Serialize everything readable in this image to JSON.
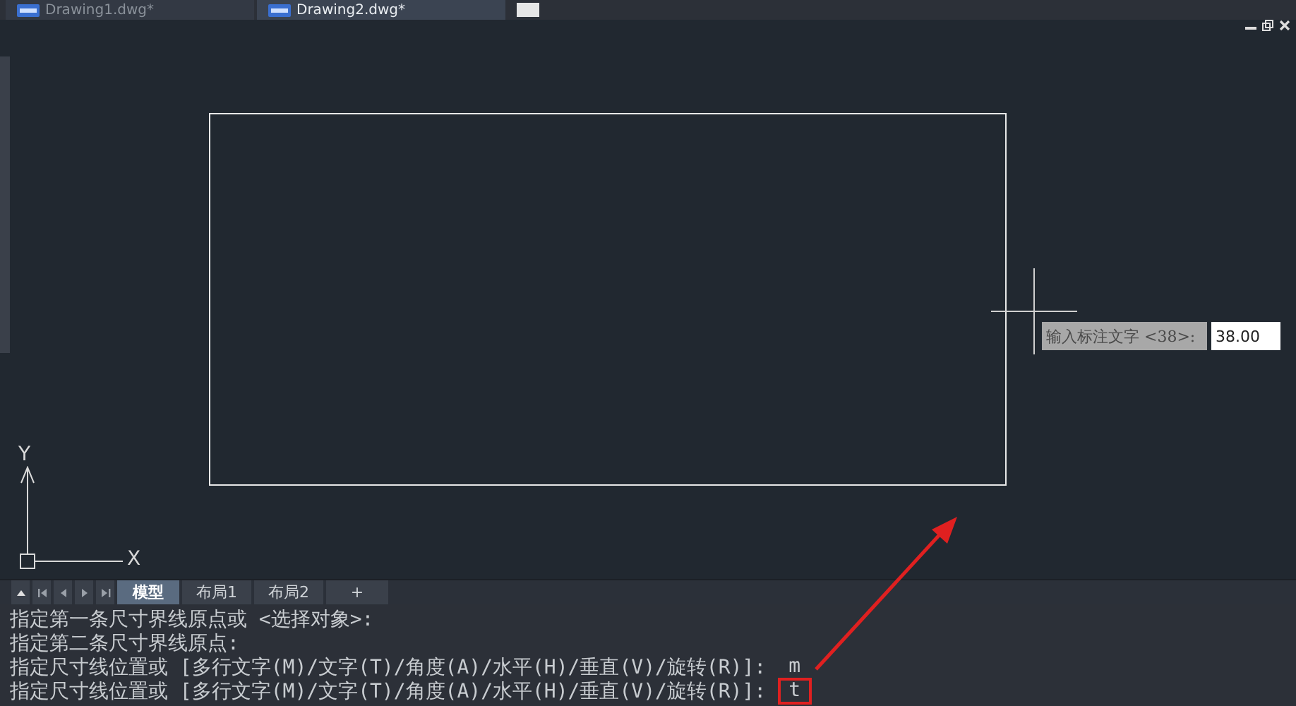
{
  "document_tabs": [
    {
      "label": "Drawing1.dwg*",
      "selected": false
    },
    {
      "label": "Drawing2.dwg*",
      "selected": true
    }
  ],
  "canvas": {
    "axis_labels": {
      "y": "Y",
      "x": "X"
    },
    "dimension_prompt": {
      "label": "输入标注文字 <38>:",
      "value": "38.00"
    }
  },
  "layout_tabs": [
    {
      "label": "模型",
      "selected": true
    },
    {
      "label": "布局1",
      "selected": false
    },
    {
      "label": "布局2",
      "selected": false
    },
    {
      "label": "+",
      "selected": false
    }
  ],
  "command_history": [
    {
      "prompt": "指定第一条尺寸界线原点或 <选择对象>:"
    },
    {
      "prompt": "指定第二条尺寸界线原点:"
    },
    {
      "prompt": "指定尺寸线位置或 [多行文字(M)/文字(T)/角度(A)/水平(H)/垂直(V)/旋转(R)]:",
      "input": "m",
      "highlighted": false
    },
    {
      "prompt": "指定尺寸线位置或 [多行文字(M)/文字(T)/角度(A)/水平(H)/垂直(V)/旋转(R)]:",
      "input": "t",
      "highlighted": true
    }
  ]
}
